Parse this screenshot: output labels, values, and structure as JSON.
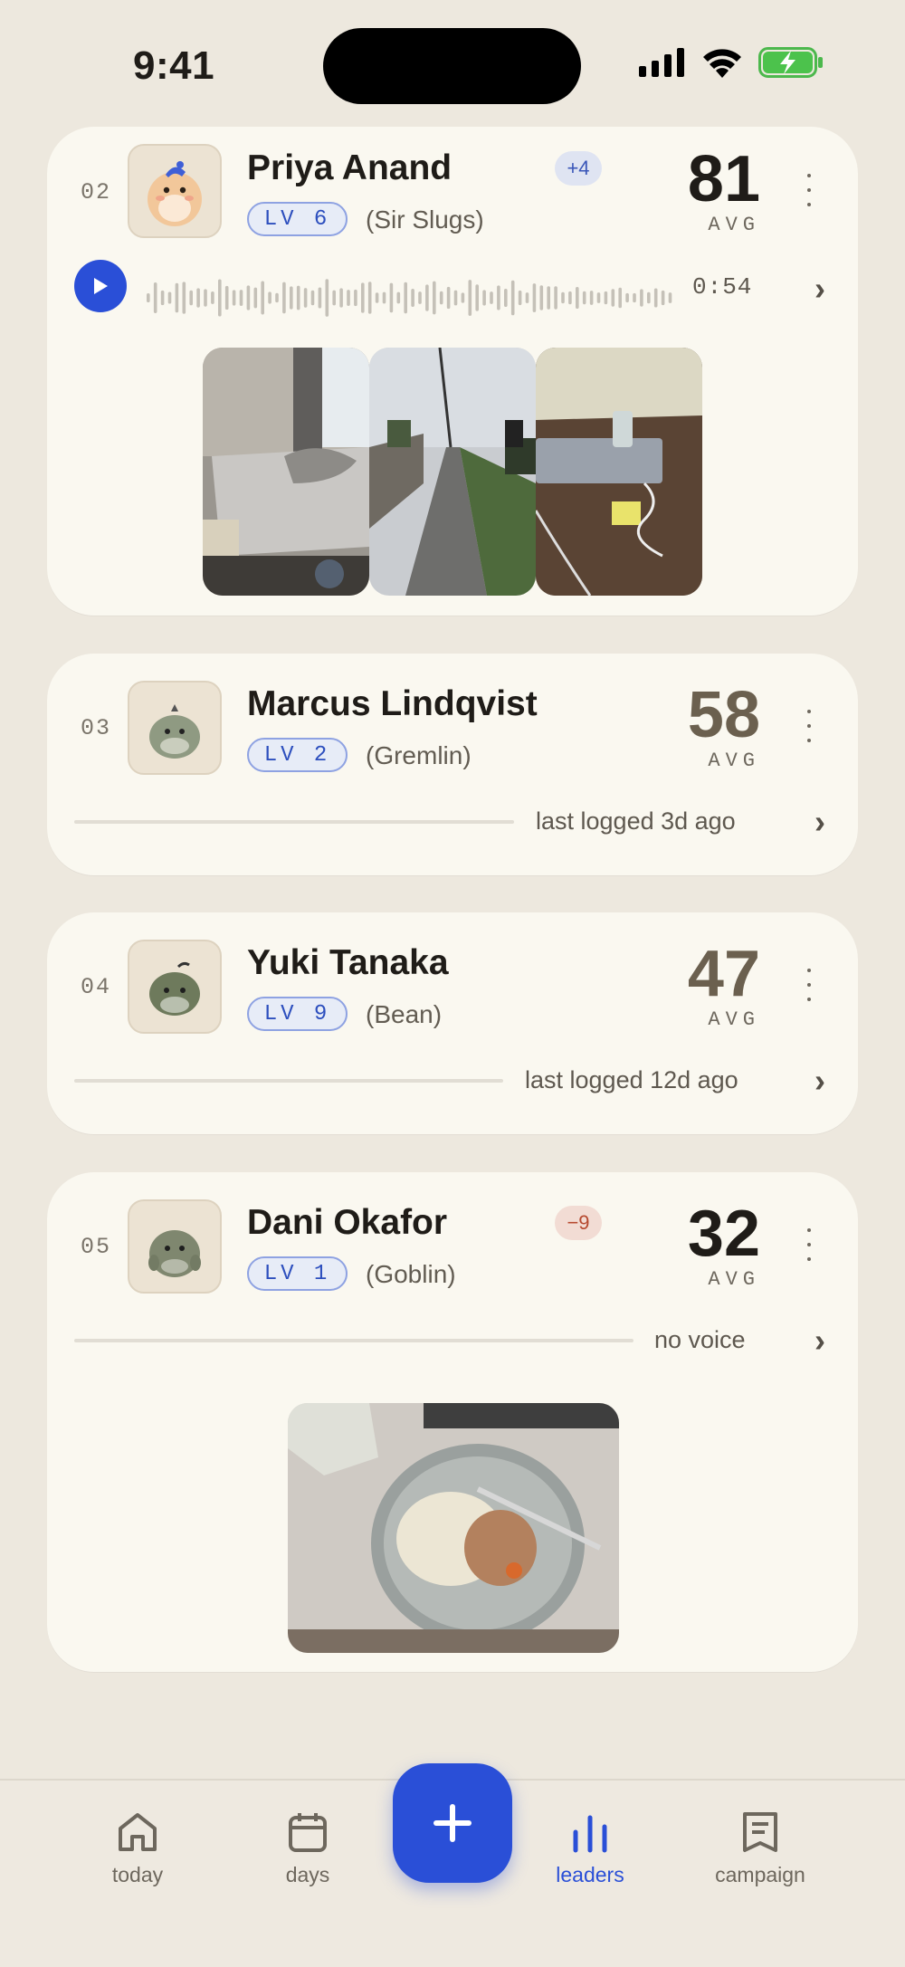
{
  "status": {
    "time": "9:41"
  },
  "cards": [
    {
      "rank": "02",
      "name": "Priya Anand",
      "level": "LV 6",
      "pet": "(Sir Slugs)",
      "delta": "+4",
      "avg": "81",
      "avg_label": "AVG",
      "duration": "0:54"
    },
    {
      "rank": "03",
      "name": "Marcus Lindqvist",
      "level": "LV 2",
      "pet": "(Gremlin)",
      "avg": "58",
      "avg_label": "AVG",
      "status": "last logged 3d ago"
    },
    {
      "rank": "04",
      "name": "Yuki Tanaka",
      "level": "LV 9",
      "pet": "(Bean)",
      "avg": "47",
      "avg_label": "AVG",
      "status": "last logged 12d ago"
    },
    {
      "rank": "05",
      "name": "Dani Okafor",
      "level": "LV 1",
      "pet": "(Goblin)",
      "delta": "−9",
      "avg": "32",
      "avg_label": "AVG",
      "status": "no voice"
    }
  ],
  "colors": {
    "accent": "#2a4fd7",
    "avg_strong": "#1f1c18",
    "avg_muted": "#6b604f"
  },
  "tabbar": {
    "tabs": [
      {
        "label": "today",
        "icon": "home-icon"
      },
      {
        "label": "days",
        "icon": "calendar-icon"
      },
      {
        "label": "leaders",
        "icon": "bar-chart-icon",
        "active": true
      },
      {
        "label": "campaign",
        "icon": "document-icon"
      }
    ],
    "fab_icon": "plus-icon"
  }
}
